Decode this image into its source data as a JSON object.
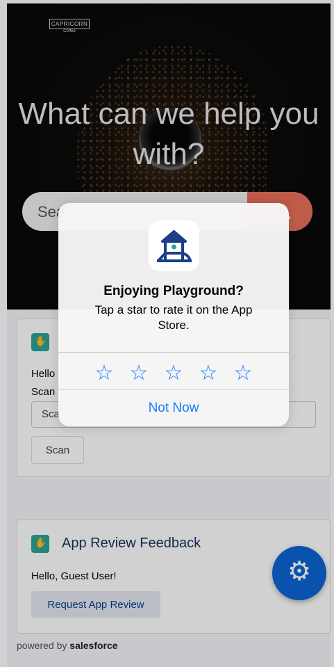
{
  "hero": {
    "logo_text": "CAPRICORN",
    "logo_sub": "Coffee",
    "title": "What can we help you with?",
    "search_placeholder": "Sea"
  },
  "card1": {
    "line1": "Hello",
    "line2": "Scan",
    "field_placeholder": "Sca",
    "button_label": "Scan"
  },
  "card2": {
    "title": "App Review Feedback",
    "greeting": "Hello, Guest User!",
    "button_label": "Request App Review"
  },
  "footer": {
    "powered_prefix": "powered by",
    "brand": "salesforce"
  },
  "alert": {
    "title": "Enjoying Playground?",
    "message": "Tap a star to rate it on the App Store.",
    "star_glyph": "☆",
    "dismiss_label": "Not Now"
  },
  "colors": {
    "accent_blue": "#157efb",
    "search_button": "#e9705a",
    "fab": "#0b66d6",
    "card_icon": "#2ca39a"
  },
  "icons": {
    "app_icon": "playground-icon",
    "search": "search-icon",
    "settings": "gear-icon",
    "card": "handshake-icon"
  }
}
